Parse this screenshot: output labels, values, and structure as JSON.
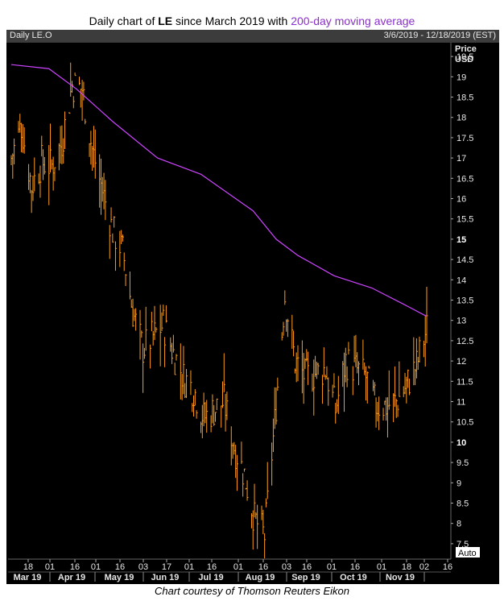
{
  "title": {
    "prefix": "Daily chart of ",
    "ticker": "LE",
    "middle": " since March 2019 with ",
    "ma_label": "200-day moving average"
  },
  "header": {
    "symbol": "Daily LE.O",
    "date_range": "3/6/2019 - 12/18/2019 (EST)"
  },
  "caption": "Chart courtesy of Thomson Reuters Eikon",
  "auto_label": "Auto",
  "chart_data": {
    "type": "ohlc",
    "ylabel": [
      "Price",
      "USD"
    ],
    "ylim": [
      7.2,
      19.8
    ],
    "yticks": [
      7.5,
      8,
      8.5,
      9,
      9.5,
      10,
      10.5,
      11,
      11.5,
      12,
      12.5,
      13,
      13.5,
      14,
      14.5,
      15,
      15.5,
      16,
      16.5,
      17,
      17.5,
      18,
      18.5,
      19,
      19.5
    ],
    "ytick_labels": [
      "7.5",
      "8",
      "8.5",
      "9",
      "9.5",
      "10",
      "10.5",
      "11",
      "11.5",
      "12",
      "12.5",
      "13",
      "13.5",
      "14",
      "14.5",
      "15",
      "15.5",
      "16",
      "16.5",
      "17",
      "17.5",
      "18",
      "18.5",
      "19",
      "19.5"
    ],
    "ytick_bold": [
      "10",
      "15"
    ],
    "x_day_ticks": [
      "18",
      "01",
      "16",
      "01",
      "16",
      "03",
      "17",
      "01",
      "16",
      "01",
      "16",
      "03",
      "16",
      "01",
      "16",
      "01",
      "18",
      "02",
      "16"
    ],
    "x_months": [
      "Mar 19",
      "Apr 19",
      "May 19",
      "Jun 19",
      "Jul 19",
      "Aug 19",
      "Sep 19",
      "Oct 19",
      "Nov 19"
    ],
    "colors": {
      "price": "#ff9c1a",
      "ma": "#cc44ff",
      "background": "#000000",
      "text": "#e6e6e6"
    },
    "series": [
      {
        "name": "LE.O",
        "x": [
          "2019-03-06",
          "2019-03-13",
          "2019-03-20",
          "2019-03-27",
          "2019-04-03",
          "2019-04-10",
          "2019-04-17",
          "2019-04-24",
          "2019-05-01",
          "2019-05-08",
          "2019-05-15",
          "2019-05-22",
          "2019-05-29",
          "2019-06-05",
          "2019-06-12",
          "2019-06-19",
          "2019-06-26",
          "2019-07-03",
          "2019-07-10",
          "2019-07-17",
          "2019-07-24",
          "2019-07-31",
          "2019-08-07",
          "2019-08-14",
          "2019-08-21",
          "2019-08-28",
          "2019-09-04",
          "2019-09-11",
          "2019-09-18",
          "2019-09-25",
          "2019-10-02",
          "2019-10-09",
          "2019-10-16",
          "2019-10-23",
          "2019-10-30",
          "2019-11-06",
          "2019-11-13",
          "2019-11-20",
          "2019-11-27",
          "2019-12-04",
          "2019-12-11",
          "2019-12-18"
        ],
        "close": [
          17.0,
          17.8,
          16.3,
          16.9,
          16.8,
          17.4,
          18.8,
          18.7,
          17.2,
          16.2,
          15.2,
          14.7,
          13.2,
          12.3,
          12.6,
          12.9,
          12.2,
          11.6,
          11.3,
          10.6,
          10.8,
          11.0,
          9.9,
          9.2,
          8.1,
          7.7,
          10.5,
          13.6,
          12.0,
          11.6,
          11.7,
          11.8,
          10.8,
          12.0,
          11.8,
          11.6,
          10.9,
          10.9,
          11.0,
          11.4,
          11.9,
          12.8
        ]
      },
      {
        "name": "200-day moving average",
        "x": [
          "2019-03-06",
          "2019-04-01",
          "2019-04-20",
          "2019-05-15",
          "2019-06-15",
          "2019-07-15",
          "2019-08-20",
          "2019-09-05",
          "2019-09-20",
          "2019-10-15",
          "2019-11-10",
          "2019-12-02",
          "2019-12-18"
        ],
        "values": [
          19.3,
          19.2,
          18.7,
          17.9,
          17.0,
          16.6,
          15.7,
          15.0,
          14.6,
          14.1,
          13.8,
          13.4,
          13.1
        ]
      }
    ]
  }
}
